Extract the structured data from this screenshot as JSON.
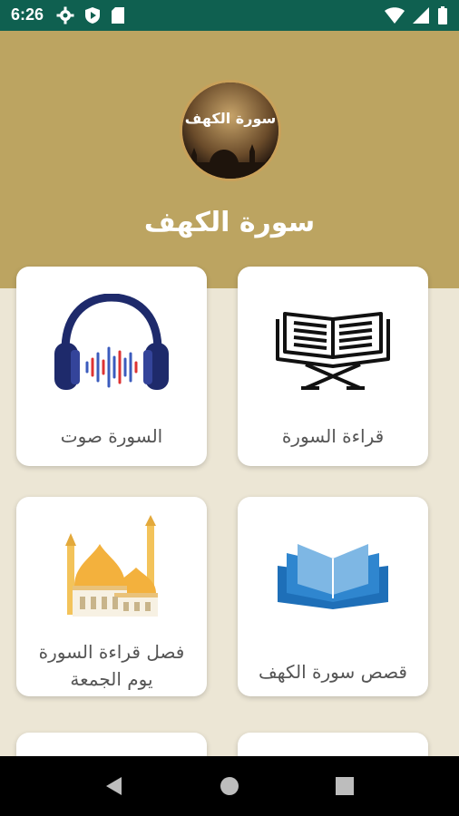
{
  "status": {
    "time": "6:26"
  },
  "header": {
    "title": "سورة الكهف",
    "logo_text": "سورة الكهف"
  },
  "cards": [
    {
      "label": "قراءة السورة",
      "icon": "open-book-icon"
    },
    {
      "label": "السورة صوت",
      "icon": "headphones-icon"
    },
    {
      "label": "قصص سورة الكهف",
      "icon": "blue-book-icon"
    },
    {
      "label_line1": "فصل قراءة السورة",
      "label_line2": "يوم الجمعة",
      "icon": "mosque-icon"
    }
  ],
  "colors": {
    "statusbar": "#0f6050",
    "header": "#bca461",
    "background": "#ece6d5",
    "card": "#ffffff"
  }
}
